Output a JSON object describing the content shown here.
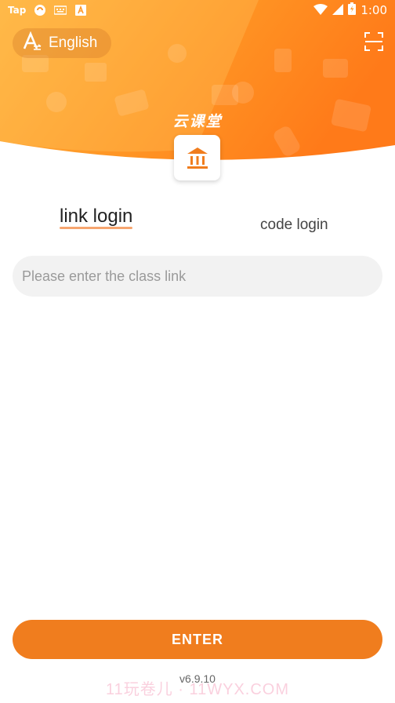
{
  "status_bar": {
    "time": "1:00",
    "left_icons": [
      "taptap-icon",
      "sync-icon",
      "keyboard-icon",
      "app-a-icon"
    ],
    "tap_label": "Tap"
  },
  "header": {
    "language_label": "English",
    "brand_title": "云课堂",
    "colors": {
      "gradient_start": "#ffb03a",
      "gradient_end": "#ff7a1a"
    }
  },
  "tabs": [
    {
      "label": "link login",
      "active": true
    },
    {
      "label": "code login",
      "active": false
    }
  ],
  "input": {
    "placeholder": "Please enter the class link",
    "value": ""
  },
  "enter_button": {
    "label": "ENTER",
    "color": "#f07d1e"
  },
  "version": "v6.9.10",
  "watermark": "11玩卷儿 · 11WYX.COM"
}
